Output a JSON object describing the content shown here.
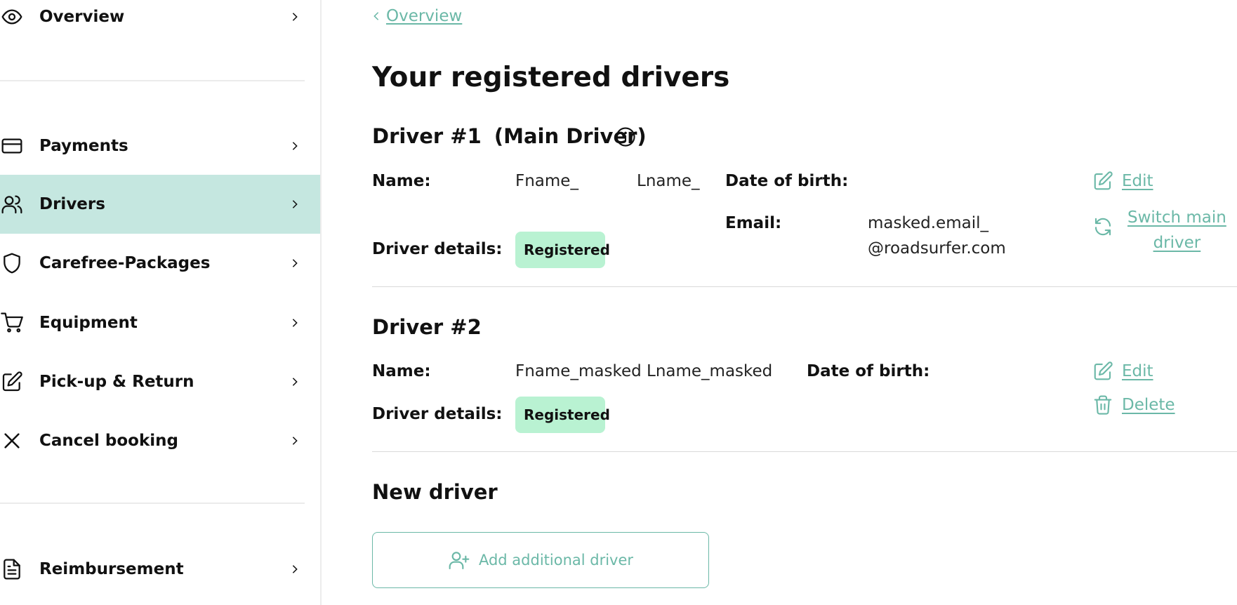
{
  "sidebar": {
    "items": [
      {
        "label": "Overview",
        "icon": "eye-icon"
      },
      {
        "label": "Payments",
        "icon": "credit-card-icon"
      },
      {
        "label": "Drivers",
        "icon": "users-icon",
        "active": true
      },
      {
        "label": "Carefree-Packages",
        "icon": "shield-icon"
      },
      {
        "label": "Equipment",
        "icon": "cart-icon"
      },
      {
        "label": "Pick-up & Return",
        "icon": "edit-icon"
      },
      {
        "label": "Cancel booking",
        "icon": "close-icon"
      },
      {
        "label": "Reimbursement",
        "icon": "document-icon"
      }
    ]
  },
  "main": {
    "back_label": "Overview",
    "page_title": "Your registered drivers",
    "driver1": {
      "title": "Driver #1",
      "subtitle": "(Main Driver)",
      "name_label": "Name:",
      "first_name": "Fname_",
      "last_name": "Lname_",
      "dob_label": "Date of birth:",
      "email_label": "Email:",
      "email_line1": "masked.email_",
      "email_line2": "@roadsurfer.com",
      "details_label": "Driver details:",
      "status": "Registered",
      "edit_label": "Edit",
      "switch_label_1": "Switch main",
      "switch_label_2": "driver"
    },
    "driver2": {
      "title": "Driver #2",
      "name_label": "Name:",
      "full_name": "Fname_masked Lname_masked",
      "dob_label": "Date of birth:",
      "details_label": "Driver details:",
      "status": "Registered",
      "edit_label": "Edit",
      "delete_label": "Delete"
    },
    "new_driver": {
      "title": "New driver",
      "add_label": "Add additional driver"
    }
  },
  "colors": {
    "accent": "#6bb8a7",
    "active_nav_bg": "#c5e7e0",
    "badge_bg": "#b9f2d2"
  }
}
